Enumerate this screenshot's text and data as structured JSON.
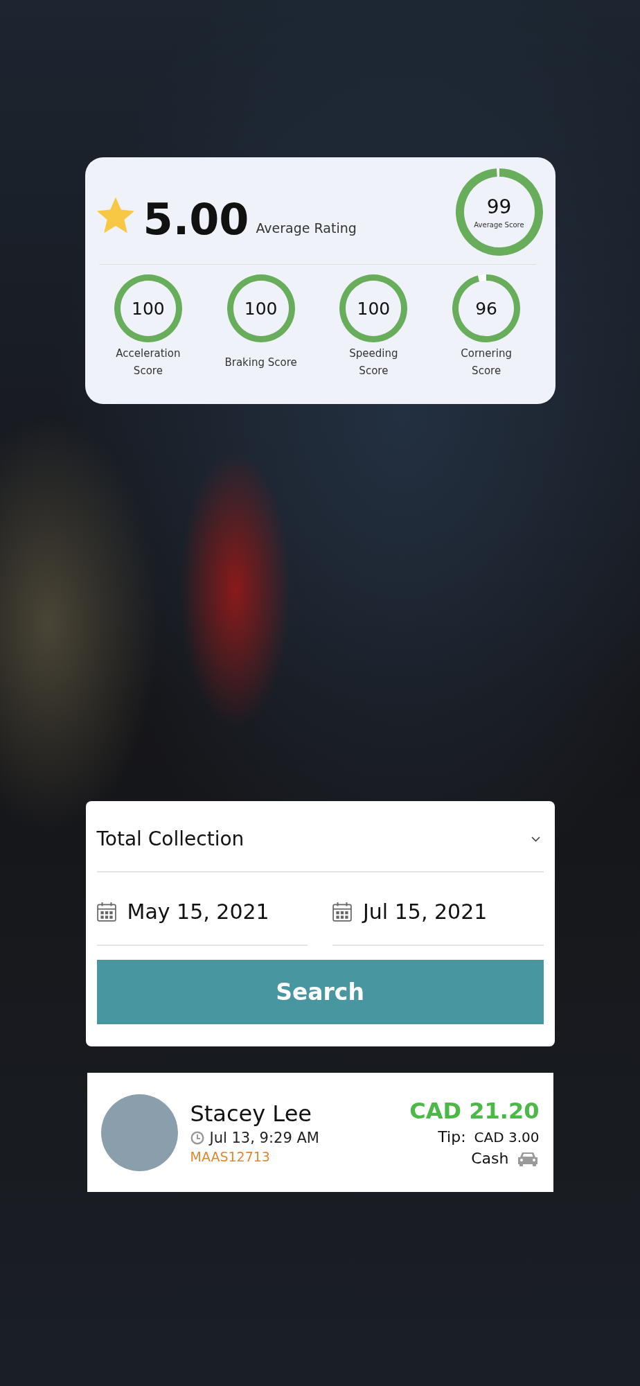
{
  "rating_card": {
    "rating": {
      "value": "5.00",
      "label": "Average Rating"
    },
    "average_score": {
      "value": "99",
      "label": "Average Score",
      "level": 0.99
    },
    "scores": [
      {
        "value": "100",
        "label": "Acceleration Score",
        "level": 1.0
      },
      {
        "value": "100",
        "label": "Braking Score",
        "level": 1.0
      },
      {
        "value": "100",
        "label": "Speeding Score",
        "level": 1.0
      },
      {
        "value": "96",
        "label": "Cornering Score",
        "level": 0.96
      }
    ]
  },
  "filter_card": {
    "dropdown": {
      "value": "Total Collection"
    },
    "dates": [
      {
        "value": "May 15, 2021"
      },
      {
        "value": "Jul 15, 2021"
      }
    ],
    "button": "Search"
  },
  "trip_card": {
    "name": "Stacey Lee",
    "time": "Jul 13, 9:29 AM",
    "code": "MAAS12713",
    "amount": "CAD 21.20",
    "tip_label": "Tip:",
    "tip_value": "CAD 3.00",
    "payment": "Cash"
  }
}
